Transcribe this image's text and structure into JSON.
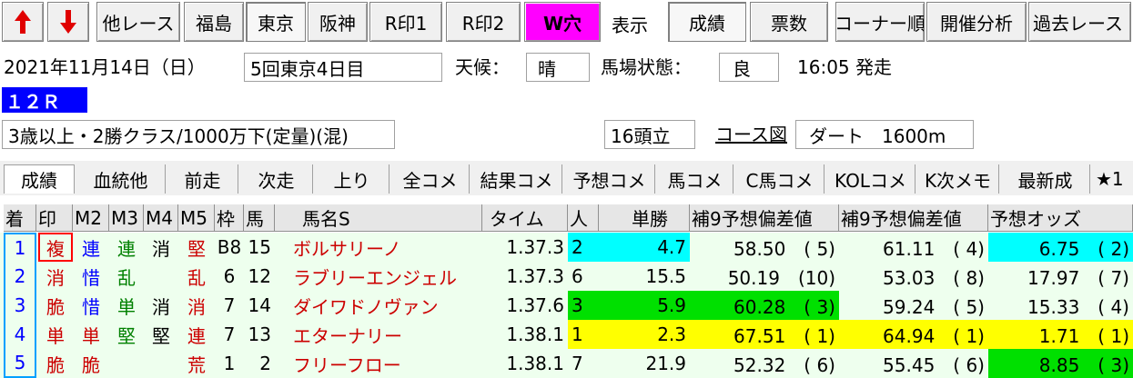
{
  "toolbar": {
    "up_arrow": "arrow-up-icon",
    "down_arrow": "arrow-down-icon",
    "other_race": "他レース",
    "venues": [
      "福島",
      "東京",
      "阪神"
    ],
    "r_mark1": "R印1",
    "r_mark2": "R印2",
    "w_hole": "W穴",
    "display_label": "表示",
    "seiseki": "成績",
    "hyosu": "票数",
    "corner": "コーナー順",
    "kaisai": "開催分析",
    "past_race": "過去レース"
  },
  "race_info": {
    "date": "2021年11月14日（日）",
    "meeting": "5回東京4日目",
    "weather_label": "天候：",
    "weather": "晴",
    "track_label": "馬場状態：",
    "track": "良",
    "start_time": "16:05 発走",
    "race_no": "１２Ｒ",
    "condition": "3歳以上・2勝クラス/1000万下(定量)(混)",
    "runners": "16頭立",
    "course_map": "コース図",
    "course": "ダート　1600m"
  },
  "tabs": [
    "成績",
    "血統他",
    "前走",
    "次走",
    "上り",
    "全コメ",
    "結果コメ",
    "予想コメ",
    "馬コメ",
    "C馬コメ",
    "KOLコメ",
    "K次メモ",
    "最新成",
    "★1"
  ],
  "table": {
    "headers": [
      "着",
      "印",
      "M2",
      "M3",
      "M4",
      "M5",
      "枠",
      "馬",
      "馬名S",
      "タイム",
      "人",
      "単勝",
      "補9予想偏差値",
      "補9予想偏差値",
      "予想オッズ"
    ],
    "rows": [
      {
        "chaku": "1",
        "m1": "複",
        "m2": "連",
        "m3": "連",
        "m4": "消",
        "m5": "堅",
        "waku": "B8",
        "uma": "15",
        "name": "ボルサリーノ",
        "time": "1.37.3",
        "ninki": "2",
        "tansho": "4.7",
        "hensa1": "58.50",
        "hensa1_rank": "( 5)",
        "hensa2": "61.11",
        "hensa2_rank": "( 4)",
        "odds": "6.75",
        "odds_rank": "( 2)"
      },
      {
        "chaku": "2",
        "m1": "消",
        "m2": "惜",
        "m3": "乱",
        "m4": "",
        "m5": "乱",
        "waku": "6",
        "uma": "12",
        "name": "ラブリーエンジェル",
        "time": "1.37.3",
        "ninki": "6",
        "tansho": "15.5",
        "hensa1": "50.19",
        "hensa1_rank": "(10)",
        "hensa2": "53.03",
        "hensa2_rank": "( 8)",
        "odds": "17.97",
        "odds_rank": "( 7)"
      },
      {
        "chaku": "3",
        "m1": "脆",
        "m2": "惜",
        "m3": "単",
        "m4": "消",
        "m5": "消",
        "waku": "7",
        "uma": "14",
        "name": "ダイワドノヴァン",
        "time": "1.37.6",
        "ninki": "3",
        "tansho": "5.9",
        "hensa1": "60.28",
        "hensa1_rank": "( 3)",
        "hensa2": "59.24",
        "hensa2_rank": "( 5)",
        "odds": "15.33",
        "odds_rank": "( 4)"
      },
      {
        "chaku": "4",
        "m1": "単",
        "m2": "単",
        "m3": "堅",
        "m4": "堅",
        "m5": "連",
        "waku": "7",
        "uma": "13",
        "name": "エターナリー",
        "time": "1.38.1",
        "ninki": "1",
        "tansho": "2.3",
        "hensa1": "67.51",
        "hensa1_rank": "( 1)",
        "hensa2": "64.94",
        "hensa2_rank": "( 1)",
        "odds": "1.71",
        "odds_rank": "( 1)"
      },
      {
        "chaku": "5",
        "m1": "脆",
        "m2": "脆",
        "m3": "",
        "m4": "",
        "m5": "荒",
        "waku": "1",
        "uma": "2",
        "name": "フリーフロー",
        "time": "1.38.1",
        "ninki": "7",
        "tansho": "21.9",
        "hensa1": "52.32",
        "hensa1_rank": "( 6)",
        "hensa2": "55.45",
        "hensa2_rank": "( 6)",
        "odds": "8.85",
        "odds_rank": "( 3)"
      }
    ]
  },
  "colors": {
    "row_bg": "#eeffee",
    "cyan": "#00ffff",
    "green": "#00e000",
    "yellow": "#ffff00",
    "blue_mark": "#0000ff",
    "red_mark": "#cc0000",
    "green_mark": "#008000",
    "race_no_bg": "#0000ff"
  }
}
